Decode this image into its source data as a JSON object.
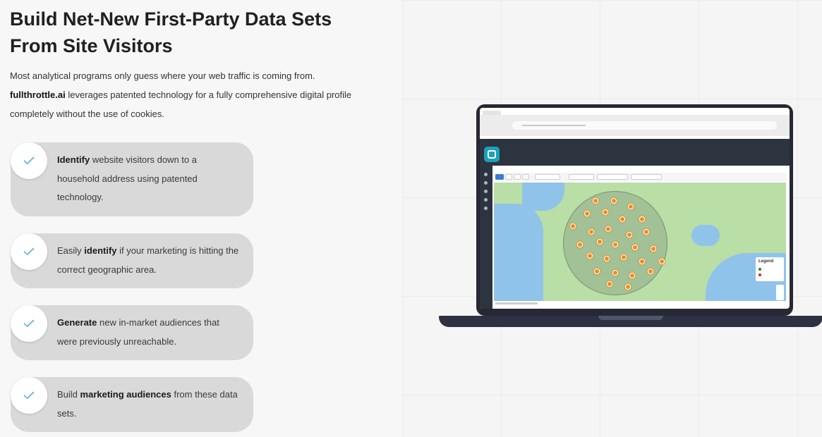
{
  "heading": {
    "line1": "Build Net-New First-Party Data Sets",
    "line2": "From Site Visitors"
  },
  "intro": {
    "line1": "Most analytical programs only guess where your web traffic is coming from.",
    "brand": "fullthrottle.ai",
    "line2_rest": " leverages patented technology for a fully comprehensive digital profile",
    "line3": "completely without the use of cookies."
  },
  "features": [
    {
      "bold": "Identify",
      "pre": "",
      "post": " website visitors down to a household address using patented technology."
    },
    {
      "pre": "Easily ",
      "bold": "identify",
      "post": " if your marketing is hitting the correct geographic area."
    },
    {
      "bold": "Generate",
      "pre": "",
      "post": " new in-market audiences that were previously unreachable."
    },
    {
      "pre": "Build ",
      "bold": "marketing audiences",
      "post": " from these data sets."
    }
  ],
  "icons": {
    "check": "check-icon",
    "app_logo": "fullthrottle-logo-icon"
  },
  "laptop_screen": {
    "legend_title": "Legend"
  },
  "colors": {
    "card_bg": "#d9d9d9",
    "check_color": "#5bb0c9",
    "pin": "#f28b1b",
    "app_header": "#2c3440",
    "laptop_body": "#262833"
  }
}
